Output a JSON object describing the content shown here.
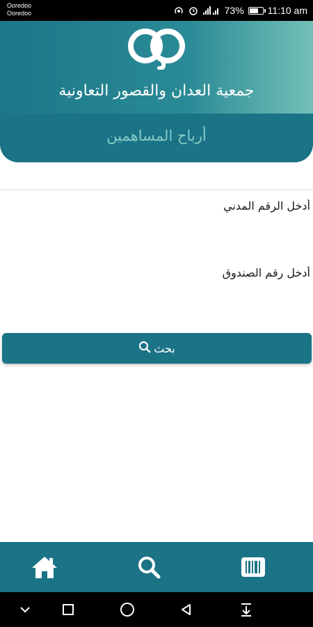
{
  "status_bar": {
    "carrier_1": "Ooredoo",
    "carrier_2": "Ooredoo",
    "battery_percent": "73%",
    "battery_level": 0.73,
    "time": "11:10 am",
    "icons": [
      "hotspot-icon",
      "alarm-icon",
      "signal-icon",
      "battery-icon"
    ]
  },
  "header": {
    "org_name": "جمعية العدان والقصور التعاونية",
    "page_title": "أرباح المساهمين",
    "gradient_start": "#1c7788",
    "gradient_end": "#73c0b7"
  },
  "form": {
    "civil_id_placeholder": "أدخل الرقم المدني",
    "box_number_placeholder": "أدخل رقم الصندوق",
    "search_label": "بحث"
  },
  "bottom_nav": {
    "items": [
      {
        "icon": "home-icon"
      },
      {
        "icon": "search-icon"
      },
      {
        "icon": "barcode-icon"
      }
    ]
  },
  "colors": {
    "primary": "#1b7386",
    "title_accent": "#86ccc6"
  }
}
